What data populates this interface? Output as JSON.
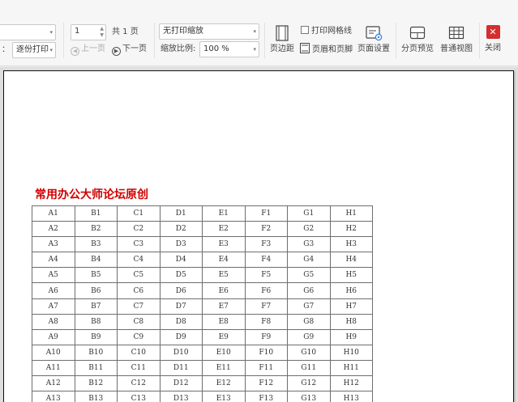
{
  "toolbar": {
    "copies_select": {
      "value": "",
      "arrow": "▾"
    },
    "collate": {
      "label_suffix": "：",
      "value": "逐份打印",
      "arrow": "▾"
    },
    "page": {
      "value": "1",
      "up": "▲",
      "down": "▼",
      "total_label": "共 1 页"
    },
    "prev_page": {
      "icon": "◀",
      "label": "上一页"
    },
    "next_page": {
      "icon": "▶",
      "label": "下一页"
    },
    "scaling": {
      "value": "无打印缩放",
      "arrow": "▾"
    },
    "zoom": {
      "label": "缩放比例:",
      "value": "100 %",
      "arrow": "▾"
    },
    "buttons": {
      "margins": "页边距",
      "print_gridlines": "打印网格线",
      "header_footer": "页眉和页脚",
      "page_setup": "页面设置",
      "page_break_preview": "分页预览",
      "normal_view": "普通视图",
      "close": "关闭",
      "close_glyph": "✕"
    },
    "print_gridlines_checked": false
  },
  "sheet": {
    "title": "常用办公大师论坛原创",
    "title_color": "#d10000",
    "columns": [
      "A",
      "B",
      "C",
      "D",
      "E",
      "F",
      "G",
      "H"
    ],
    "row_count": 13
  },
  "colors": {
    "close_button": "#d32f2f",
    "toolbar_bg": "#f6f6f6",
    "preview_bg": "#dedede"
  }
}
